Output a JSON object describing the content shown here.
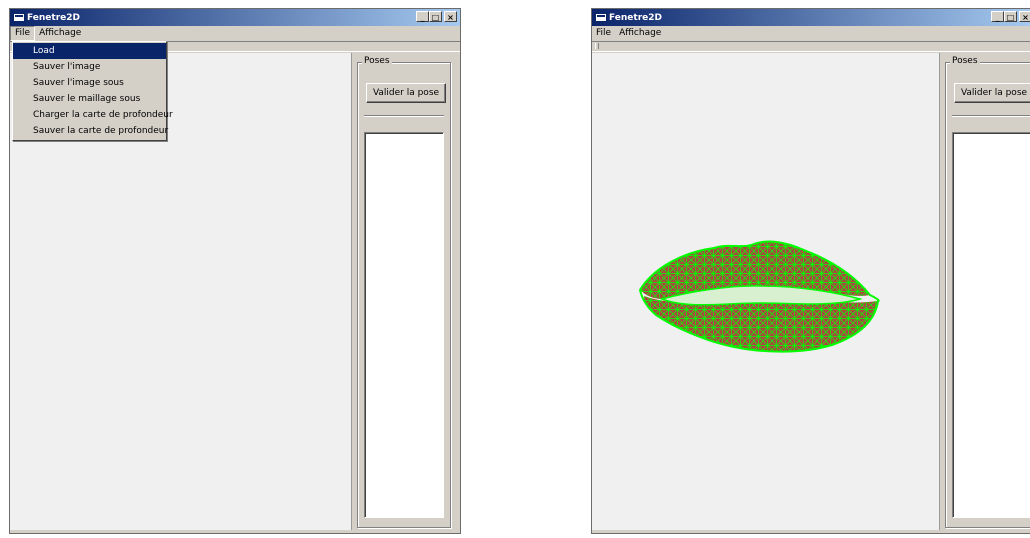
{
  "left_window": {
    "title": "Fenetre2D",
    "caption_buttons": [
      "_",
      "□",
      "×"
    ],
    "menu": [
      "File",
      "Affichage"
    ],
    "file_menu_items": [
      "Load",
      "Sauver l'image",
      "Sauver l'image sous",
      "Sauver le maillage sous",
      "Charger la carte de profondeur",
      "Sauver la carte de profondeur"
    ],
    "poses_group_label": "Poses",
    "validate_button": "Valider la pose"
  },
  "right_window": {
    "title": "Fenetre2D",
    "caption_buttons": [
      "_",
      "□",
      "×"
    ],
    "menu": [
      "File",
      "Affichage"
    ],
    "poses_group_label": "Poses",
    "validate_button": "Valider la pose",
    "canvas_content": "lips-mesh"
  },
  "colors": {
    "titlebar_start": "#0a246a",
    "titlebar_end": "#a6caf0",
    "mesh_green": "#00ff00",
    "lip_fill": "#a84a3e",
    "menu_highlight": "#0a246a"
  },
  "icons": [
    "app-icon",
    "minimize-icon",
    "maximize-icon",
    "close-icon"
  ]
}
